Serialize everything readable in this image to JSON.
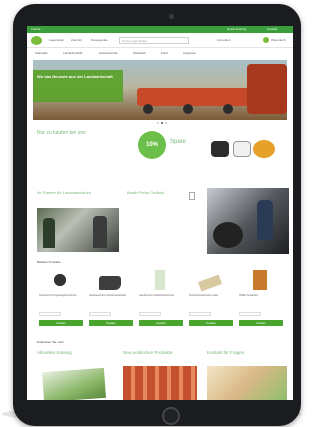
{
  "screen": {
    "topbar": {
      "left": "Tractor...",
      "right_items": [
        "Gratis levering",
        "Kontakt"
      ]
    },
    "header": {
      "items": [
        "Lagerfelder",
        "Zubehör",
        "Dieselgeräte"
      ],
      "search_placeholder": "Suche nach Artikel",
      "right_items": [
        "Anmelden",
        "Warenkorb"
      ]
    },
    "nav": {
      "items": [
        "Startseite",
        "Landwirtschaft",
        "Gartentechnik",
        "Werkstatt",
        "Forst",
        "Angebote"
      ]
    },
    "hero": {
      "title": "Wo das Neueste aus der Landwirtschaft",
      "slides": 3,
      "active_slide": 1
    },
    "promo": {
      "left_text": "Nur zu kaufen bei uns",
      "badge": "10%",
      "badge_text": "Spare"
    },
    "cards": [
      {
        "title": "Ihr Partner für Landmaschinen"
      },
      {
        "title": "Beste Preise Technik"
      }
    ],
    "products_heading": "Beliebte Produkte",
    "products": [
      {
        "name": "Gehörschutz Kapselgehörschutz",
        "buy": "Kaufen"
      },
      {
        "name": "Arbeitsschuhe Sicherheitsstiefel",
        "buy": "Kaufen"
      },
      {
        "name": "Handschutz Arbeitshandschuh",
        "buy": "Kaufen"
      },
      {
        "name": "Schutzhandschuhe Leder",
        "buy": "Kaufen"
      },
      {
        "name": "Ölfilter Ersatzteil",
        "buy": "Kaufen"
      }
    ],
    "footer_heading": "Entdecken Sie mehr",
    "footer_columns": [
      {
        "title": "Aktuelles Katalog"
      },
      {
        "title": "Neu entdecken Produkte"
      },
      {
        "title": "Kontakt für Fragen"
      }
    ]
  }
}
